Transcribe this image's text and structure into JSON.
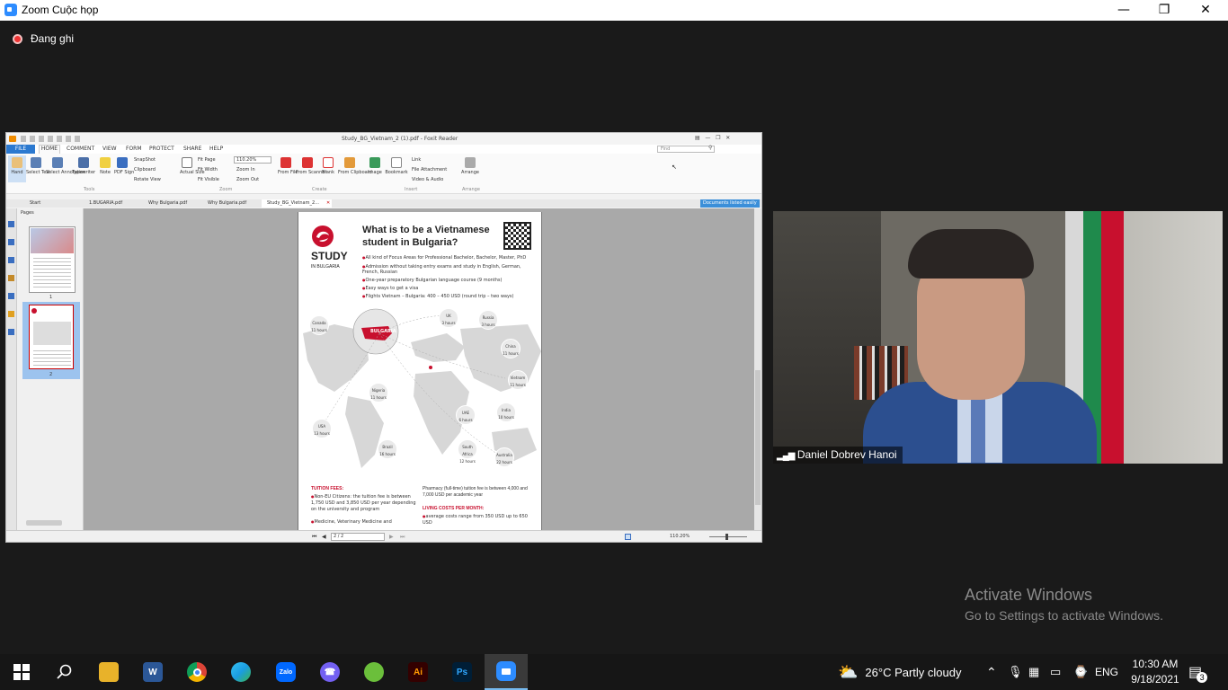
{
  "zoom": {
    "window_title": "Zoom Cuộc họp",
    "recording_label": "Đang ghi"
  },
  "foxit": {
    "title": "Study_BG_Vietnam_2 (1).pdf - Foxit Reader",
    "menu": [
      "FILE",
      "HOME",
      "COMMENT",
      "VIEW",
      "FORM",
      "PROTECT",
      "SHARE",
      "HELP"
    ],
    "search_placeholder": "Find",
    "tools": {
      "hand": "Hand",
      "select_text": "Select Text",
      "select_annotation": "Select Annotation",
      "typewriter": "Typewriter",
      "note": "Note",
      "pdf_sign": "PDF Sign",
      "snapshot": "SnapShot",
      "clipboard": "Clipboard",
      "rotate_view": "Rotate View",
      "actual_size": "Actual Size",
      "fit_page": "Fit Page",
      "fit_width": "Fit Width",
      "fit_visible": "Fit Visible",
      "zoom_value": "110.20%",
      "zoom_in": "Zoom In",
      "zoom_out": "Zoom Out",
      "from_file": "From File",
      "from_scanner": "From Scanner",
      "blank": "Blank",
      "from_clipboard": "From Clipboard",
      "image": "Image",
      "bookmark": "Bookmark",
      "link": "Link",
      "file_attachment": "File Attachment",
      "video_audio": "Video & Audio",
      "arrange": "Arrange"
    },
    "groups": {
      "tools": "Tools",
      "zoom": "Zoom",
      "create": "Create",
      "insert": "Insert",
      "arrange": "Arrange"
    },
    "tabs": [
      "Start",
      "1.BUGARIA.pdf",
      "Why Bulgaria.pdf",
      "Why Bulgaria.pdf",
      "Study_BG_Vietnam_2..."
    ],
    "tabs_right_badge": "Documents listed easily",
    "pages_label": "Pages",
    "thumb_numbers": [
      "1",
      "2"
    ],
    "page_nav": "2 / 2",
    "status_zoom": "110.20%"
  },
  "pdf": {
    "logo_line1": "STUDY",
    "logo_line2": "IN BULGARIA",
    "heading": "What is to be a Vietnamese student in Bulgaria?",
    "bullets": [
      "All kind of Focus Areas for Professional Bachelor, Bachelor, Master, PhD",
      "Admission without taking entry exams and study in English, German, French, Russian",
      "One-year preparatory Bulgarian language course (9 months)",
      "Easy ways to get a visa",
      "Flights Vietnam – Bulgaria: 400 – 450 USD (round trip – two ways)"
    ],
    "map_center": "BULGARIA",
    "cities": [
      {
        "name": "Canada",
        "hours": "11 hours"
      },
      {
        "name": "UK",
        "hours": "3 hours"
      },
      {
        "name": "Russia",
        "hours": "3 hours"
      },
      {
        "name": "China",
        "hours": "11 hours"
      },
      {
        "name": "Vietnam",
        "hours": "11 hours"
      },
      {
        "name": "Nigeria",
        "hours": "11 hours"
      },
      {
        "name": "UAE",
        "hours": "6 hours"
      },
      {
        "name": "India",
        "hours": "10 hours"
      },
      {
        "name": "USA",
        "hours": "13 hours"
      },
      {
        "name": "Brazil",
        "hours": "16 hours"
      },
      {
        "name": "South Africa",
        "hours": "12 hours"
      },
      {
        "name": "Australia",
        "hours": "22 hours"
      }
    ],
    "tuition_title": "TUITION FEES:",
    "tuition_text": "Non-EU Citizens: the tuition fee is between 1,750 USD and 3,850 USD per year depending on the university and program",
    "medicine_text": "Medicine, Veterinary Medicine and",
    "pharmacy_text": "Pharmacy (full-time) tuition fee is between 4,000 and 7,000 USD per academic year",
    "living_title": "LIVING COSTS PER MONTH:",
    "living_text": "average costs range from 350 USD up to 650 USD"
  },
  "video": {
    "participant_name": "Daniel Dobrev Hanoi"
  },
  "activate": {
    "line1": "Activate Windows",
    "line2": "Go to Settings to activate Windows."
  },
  "taskbar": {
    "apps": [
      "Start",
      "Search",
      "File Explorer",
      "Word",
      "Chrome",
      "Edge",
      "Zalo",
      "Viber",
      "Coc Coc",
      "Illustrator",
      "Photoshop",
      "Zoom"
    ],
    "zalo_label": "Zalo",
    "ai_label": "Ai",
    "ps_label": "Ps",
    "word_label": "W",
    "weather": "26°C  Partly cloudy",
    "language": "ENG",
    "time": "10:30 AM",
    "date": "9/18/2021",
    "notifications": "3"
  }
}
